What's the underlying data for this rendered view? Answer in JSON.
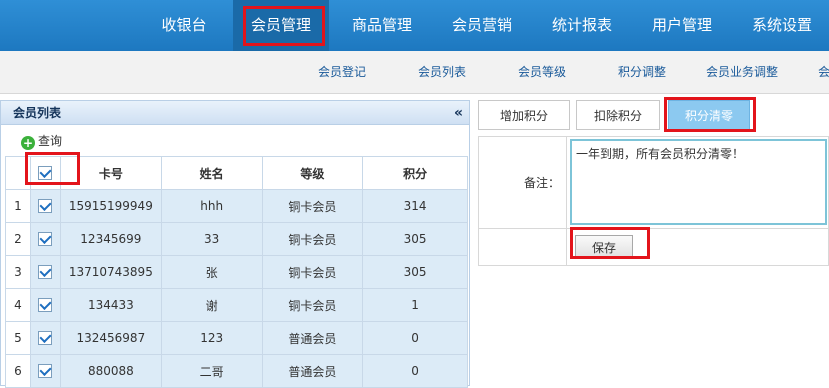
{
  "topnav": {
    "items": [
      {
        "label": "收银台"
      },
      {
        "label": "会员管理"
      },
      {
        "label": "商品管理"
      },
      {
        "label": "会员营销"
      },
      {
        "label": "统计报表"
      },
      {
        "label": "用户管理"
      },
      {
        "label": "系统设置"
      }
    ],
    "active_index": 1
  },
  "subnav": {
    "items": [
      {
        "label": "会员登记"
      },
      {
        "label": "会员列表"
      },
      {
        "label": "会员等级"
      },
      {
        "label": "积分调整"
      },
      {
        "label": "会员业务调整"
      },
      {
        "label": "会"
      }
    ]
  },
  "left_panel": {
    "title": "会员列表",
    "collapse_icon": "«",
    "query_label": "查询",
    "columns": [
      "卡号",
      "姓名",
      "等级",
      "积分"
    ],
    "rows": [
      {
        "num": "1",
        "card": "15915199949",
        "name": "hhh",
        "level": "铜卡会员",
        "points": "314"
      },
      {
        "num": "2",
        "card": "12345699",
        "name": "33",
        "level": "铜卡会员",
        "points": "305"
      },
      {
        "num": "3",
        "card": "13710743895",
        "name": "张",
        "level": "铜卡会员",
        "points": "305"
      },
      {
        "num": "4",
        "card": "134433",
        "name": "谢",
        "level": "铜卡会员",
        "points": "1"
      },
      {
        "num": "5",
        "card": "132456987",
        "name": "123",
        "level": "普通会员",
        "points": "0"
      },
      {
        "num": "6",
        "card": "880088",
        "name": "二哥",
        "level": "普通会员",
        "points": "0"
      }
    ]
  },
  "right_panel": {
    "tabs": [
      {
        "label": "增加积分"
      },
      {
        "label": "扣除积分"
      },
      {
        "label": "积分清零"
      }
    ],
    "active_tab": 2,
    "remark_label": "备注：",
    "remark_value": "一年到期，所有会员积分清零！",
    "save_label": "保存"
  },
  "colors": {
    "nav_blue": "#1d78c0",
    "highlight_red": "#e3141b",
    "row_blue": "#dcebf7",
    "active_tab": "#8cc9f0"
  }
}
